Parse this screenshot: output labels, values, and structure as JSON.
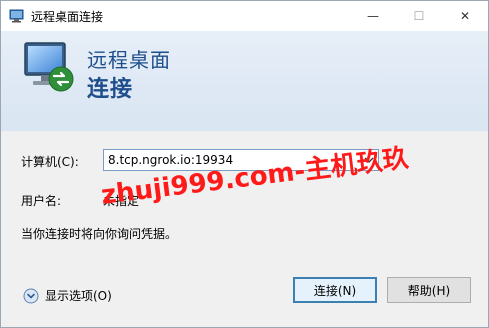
{
  "window": {
    "title": "远程桌面连接",
    "controls": {
      "minimize": "—",
      "maximize": "☐",
      "close": "✕"
    }
  },
  "header": {
    "line1": "远程桌面",
    "line2": "连接"
  },
  "form": {
    "computer_label": "计算机(C):",
    "computer_value": "8.tcp.ngrok.io:19934",
    "username_label": "用户名:",
    "username_value": "未指定",
    "credentials_note": "当你连接时将向你询问凭据。"
  },
  "watermark": "zhuji999.com-主机玖玖",
  "footer": {
    "options_label": "显示选项(O)",
    "connect_button": "连接(N)",
    "help_button": "帮助(H)"
  },
  "colors": {
    "header_text": "#1e4e8c",
    "watermark": "#ff1a1a",
    "default_button_border": "#3c7fb1"
  }
}
